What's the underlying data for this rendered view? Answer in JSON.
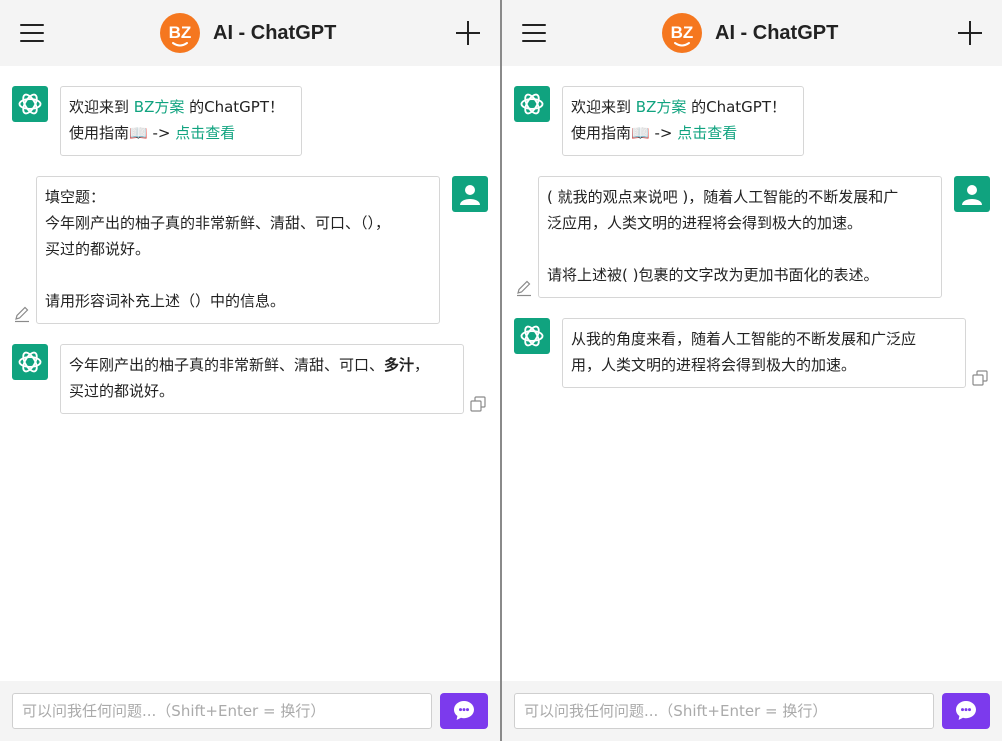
{
  "colors": {
    "accent": "#10a37f",
    "logo": "#f5771f",
    "send_button": "#7c3aed",
    "header_bg": "#f4f4f4"
  },
  "left": {
    "header": {
      "logo_text": "BZ",
      "title": "AI - ChatGPT"
    },
    "welcome": {
      "l1_pre": "欢迎来到 ",
      "l1_link": "BZ方案",
      "l1_post": " 的ChatGPT！",
      "l2_pre": "使用指南📖 -> ",
      "l2_link": "点击查看"
    },
    "user_message": {
      "lines": [
        "填空题：",
        "今年刚产出的柚子真的非常新鲜、清甜、可口、（），",
        "买过的都说好。",
        "",
        "请用形容词补充上述（）中的信息。"
      ]
    },
    "reply": {
      "l1_pre": "今年刚产出的柚子真的非常新鲜、清甜、可口、",
      "l1_bold": "多汁",
      "l1_post": "，",
      "l2": "买过的都说好。"
    },
    "input": {
      "placeholder": "可以问我任何问题...（Shift+Enter = 换行）"
    }
  },
  "right": {
    "header": {
      "logo_text": "BZ",
      "title": "AI - ChatGPT"
    },
    "welcome": {
      "l1_pre": "欢迎来到 ",
      "l1_link": "BZ方案",
      "l1_post": " 的ChatGPT！",
      "l2_pre": "使用指南📖 -> ",
      "l2_link": "点击查看"
    },
    "user_message": {
      "lines": [
        "( 就我的观点来说吧 )，随着人工智能的不断发展和广",
        "泛应用，人类文明的进程将会得到极大的加速。",
        "",
        "请将上述被( )包裹的文字改为更加书面化的表述。"
      ]
    },
    "reply": {
      "lines": [
        "从我的角度来看，随着人工智能的不断发展和广泛应",
        "用，人类文明的进程将会得到极大的加速。"
      ]
    },
    "input": {
      "placeholder": "可以问我任何问题...（Shift+Enter = 换行）"
    }
  }
}
